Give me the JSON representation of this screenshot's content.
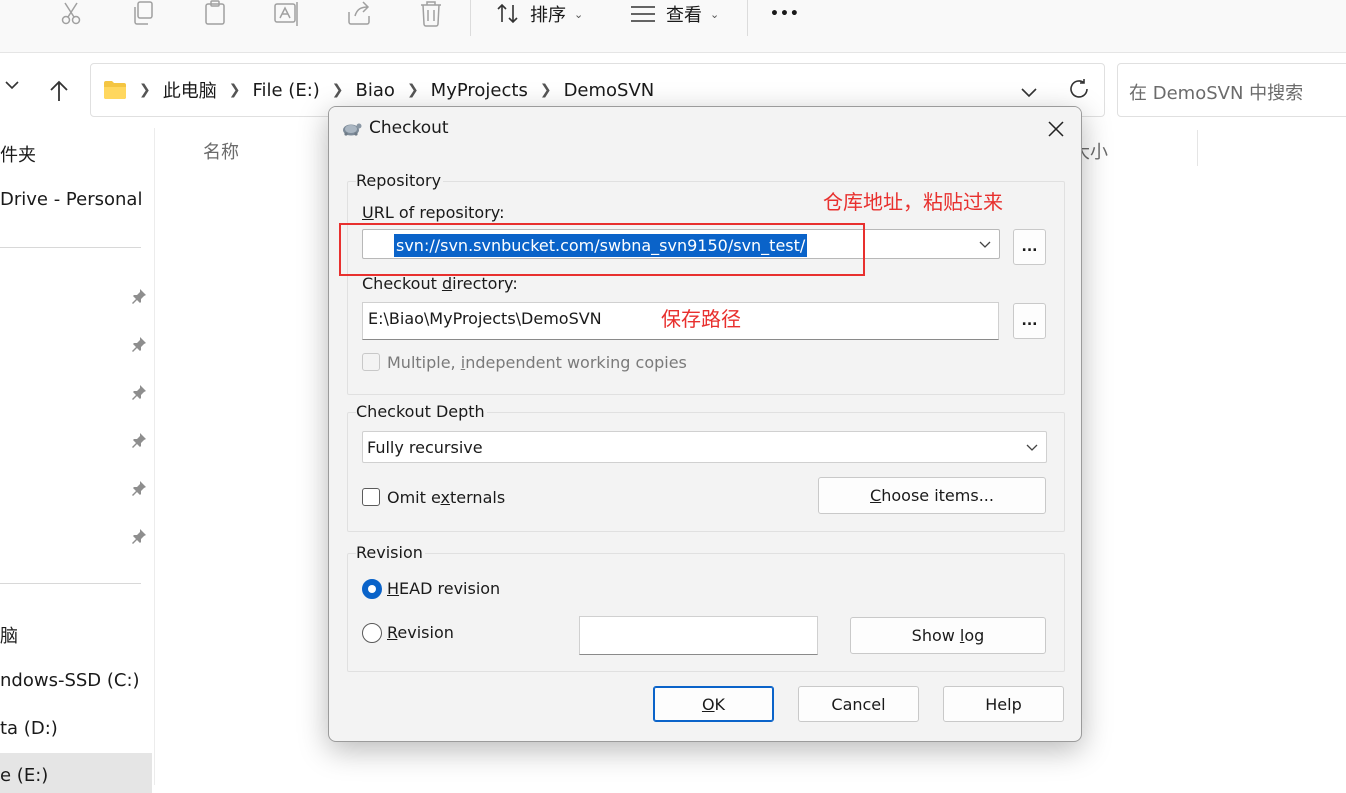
{
  "toolbar": {
    "sort_label": "排序",
    "view_label": "查看",
    "more_label": "•••"
  },
  "breadcrumb": {
    "items": [
      "此电脑",
      "File (E:)",
      "Biao",
      "MyProjects",
      "DemoSVN"
    ]
  },
  "search": {
    "placeholder": "在 DemoSVN 中搜索"
  },
  "sidebar": {
    "items": [
      "件夹",
      "Drive - Personal",
      "脑",
      "ndows-SSD (C:)",
      "ta (D:)",
      "e (E:)"
    ]
  },
  "file_list": {
    "col_name": "名称",
    "col_size": "大小"
  },
  "dialog": {
    "title": "Checkout",
    "repository_group": "Repository",
    "url_label": "URL of repository:",
    "url_value": "svn://svn.svnbucket.com/swbna_svn9150/svn_test/",
    "browse_label": "...",
    "dir_label": "Checkout directory:",
    "dir_value": "E:\\Biao\\MyProjects\\DemoSVN",
    "multiple_label": "Multiple, independent working copies",
    "depth_group": "Checkout Depth",
    "depth_value": "Fully recursive",
    "omit_label": "Omit externals",
    "choose_label": "Choose items...",
    "revision_group": "Revision",
    "head_label": "HEAD revision",
    "revision_label": "Revision",
    "revision_value": "",
    "showlog_label": "Show log",
    "ok_label": "OK",
    "cancel_label": "Cancel",
    "help_label": "Help"
  },
  "annotations": {
    "url_note": "仓库地址，粘贴过来",
    "dir_note": "保存路径",
    "color": "#e8302e"
  },
  "colors": {
    "accent": "#0a63c9",
    "dialog_bg": "#f3f3f3"
  }
}
